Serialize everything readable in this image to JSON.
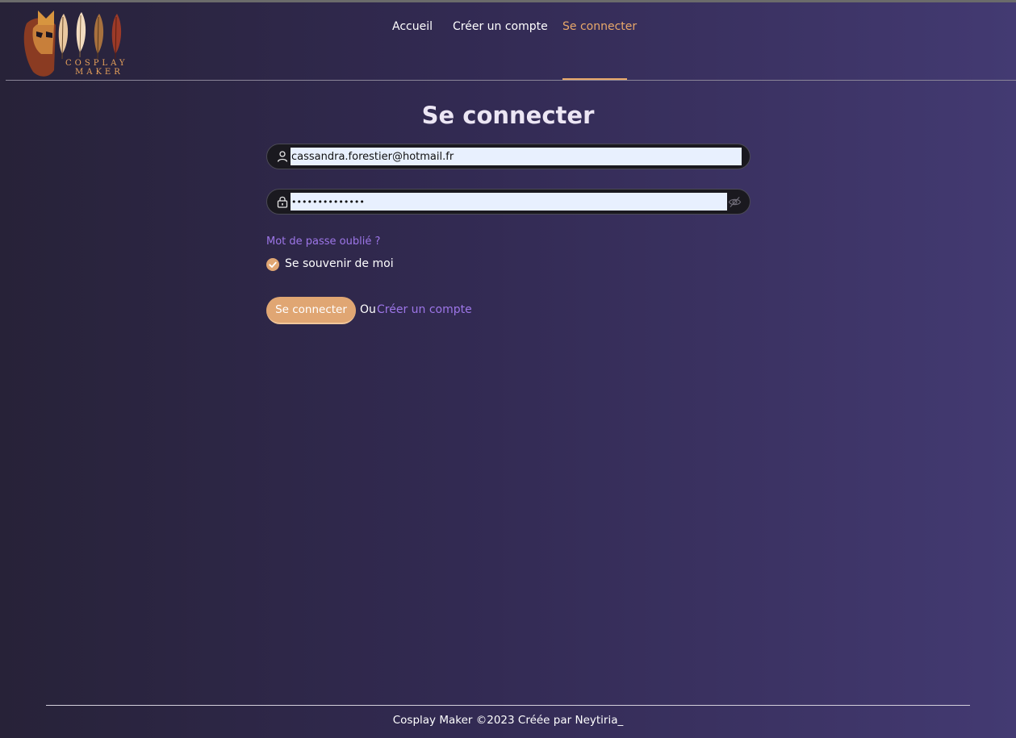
{
  "brand": {
    "logo_line1": "COSPLAY",
    "logo_line2": "MAKER"
  },
  "nav": {
    "items": [
      {
        "label": "Accueil"
      },
      {
        "label": "Créer un compte"
      },
      {
        "label": "Se connecter",
        "active": true
      }
    ],
    "active_color": "#e8a86a"
  },
  "login": {
    "title": "Se connecter",
    "email_value": "cassandra.forestier@hotmail.fr",
    "email_icon": "user-icon",
    "password_value": "••••••••••••••",
    "password_icon": "lock-icon",
    "toggle_icon": "eye-slash-icon",
    "forgot_password": "Mot de passe oublié ?",
    "remember_me": "Se souvenir de moi",
    "remember_checked": true,
    "submit_label": "Se connecter",
    "or_text": "Ou",
    "create_account_link": "Créer un compte"
  },
  "footer": {
    "text": "Cosplay Maker ©2023 Créée par Neytiria_"
  },
  "colors": {
    "accent": "#e0a673",
    "link": "#9d76e8",
    "background_start": "#272238",
    "background_end": "#433a72"
  }
}
